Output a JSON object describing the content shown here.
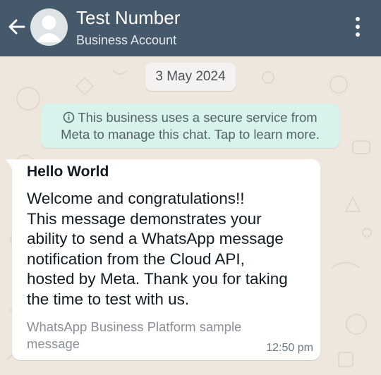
{
  "header": {
    "title": "Test Number",
    "subtitle": "Business Account",
    "background": "#46596b",
    "icons": {
      "back": "arrow-left-icon",
      "avatar": "default-avatar-icon",
      "menu": "more-vertical-icon"
    }
  },
  "chat": {
    "date_label": "3 May 2024",
    "notice": {
      "icon": "info-icon",
      "line1": "This business uses a secure service from",
      "line2": "Meta to manage this chat. Tap to learn more."
    },
    "message": {
      "title": "Hello World",
      "body_lines": [
        "Welcome and congratulations!!",
        "This message demonstrates your",
        "ability to send a WhatsApp message",
        "notification from the Cloud API,",
        "hosted by Meta. Thank you for taking",
        "the time to test with us."
      ],
      "footer_lines": [
        "WhatsApp Business Platform sample",
        "message"
      ],
      "time": "12:50 pm"
    }
  },
  "colors": {
    "wallpaper": "#efe7dd",
    "notice_bg": "#d8f2ec",
    "bubble_bg": "#ffffff"
  }
}
